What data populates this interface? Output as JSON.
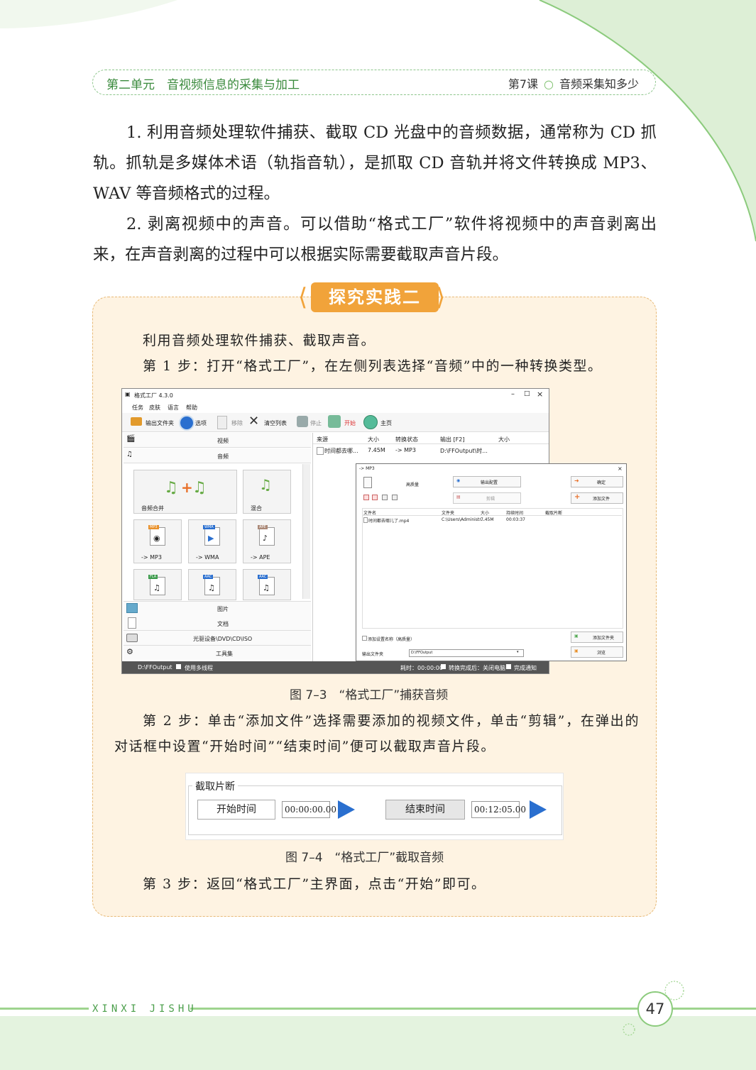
{
  "header": {
    "unit": "第二单元　音视频信息的采集与加工",
    "lesson": "第7课",
    "lesson_title": "音频采集知多少"
  },
  "paragraphs": [
    "1. 利用音频处理软件捕获、截取 CD 光盘中的音频数据，通常称为 CD 抓轨。抓轨是多媒体术语（轨指音轨），是抓取 CD 音轨并将文件转换成 MP3、WAV 等音频格式的过程。",
    "2. 剥离视频中的声音。可以借助“格式工厂”软件将视频中的声音剥离出来，在声音剥离的过程中可以根据实际需要截取声音片段。"
  ],
  "practice": {
    "title": "探究实践二",
    "intro": "利用音频处理软件捕获、截取声音。",
    "step1": "第 1 步：打开“格式工厂”，在左侧列表选择“音频”中的一种转换类型。",
    "fig1_caption": "图 7–3　“格式工厂”捕获音频",
    "step2": "第 2 步：单击“添加文件”选择需要添加的视频文件，单击“剪辑”，在弹出的对话框中设置“开始时间”“结束时间”便可以截取声音片段。",
    "fig2_caption": "图 7–4　“格式工厂”截取音频",
    "step3": "第 3 步：返回“格式工厂”主界面，点击“开始”即可。"
  },
  "app": {
    "title": "格式工厂 4.3.0",
    "menu": [
      "任务",
      "皮肤",
      "语言",
      "帮助"
    ],
    "toolbar": [
      "输出文件夹",
      "选项",
      "移除",
      "清空列表",
      "停止",
      "开始",
      "主页"
    ],
    "categories": [
      "视频",
      "音频",
      "图片",
      "文档",
      "光驱设备\\DVD\\CD\\ISO",
      "工具集"
    ],
    "tiles": [
      "音频合并",
      "混合",
      "-> MP3",
      "-> WMA",
      "-> APE"
    ],
    "tile_tags": [
      "MP3",
      "WMA",
      "APE",
      "FLA",
      "AAC",
      "AAC"
    ],
    "columns": [
      "来源",
      "大小",
      "转换状态",
      "输出 [F2]",
      "大小"
    ],
    "row": [
      "时间都去哪...",
      "7.45M",
      "-> MP3",
      "D:\\FFOutput\\时..."
    ],
    "status_left": "D:\\FFOutput",
    "status_multithread": "使用多线程",
    "status_right": "耗时：00:00:00",
    "status_shutdown": "转换完成后：关闭电脑",
    "status_notify": "完成通知",
    "window_controls": [
      "–",
      "□",
      "×"
    ]
  },
  "dialog": {
    "title": "-> MP3",
    "quality": "高质量",
    "output_settings": "输出配置",
    "ok": "确定",
    "add_file": "添加文件",
    "clip": "剪辑",
    "columns": [
      "文件名",
      "文件夹",
      "大小",
      "持续时间",
      "截取片断"
    ],
    "row": [
      "时间都去哪儿了.mp4",
      "C:\\Users\\Administr...",
      "7.45M",
      "00:03:37",
      ""
    ],
    "add_setting_name": "添加设置名称（高质量）",
    "add_folder": "添加文件夹",
    "output_folder_label": "输出文件夹",
    "output_folder_value": "D:\\FFOutput",
    "browse": "浏览",
    "close": "×"
  },
  "clip_panel": {
    "title": "截取片断",
    "start_label": "开始时间",
    "start_value": "00:00:00.00",
    "end_label": "结束时间",
    "end_value": "00:12:05.00"
  },
  "footer": {
    "text": "XINXI JISHU",
    "page": "47"
  },
  "colors": {
    "green": "#8cc58a",
    "orange": "#f1a33a",
    "box_bg": "#fef3e2",
    "arrow_blue": "#2a6fcf"
  }
}
